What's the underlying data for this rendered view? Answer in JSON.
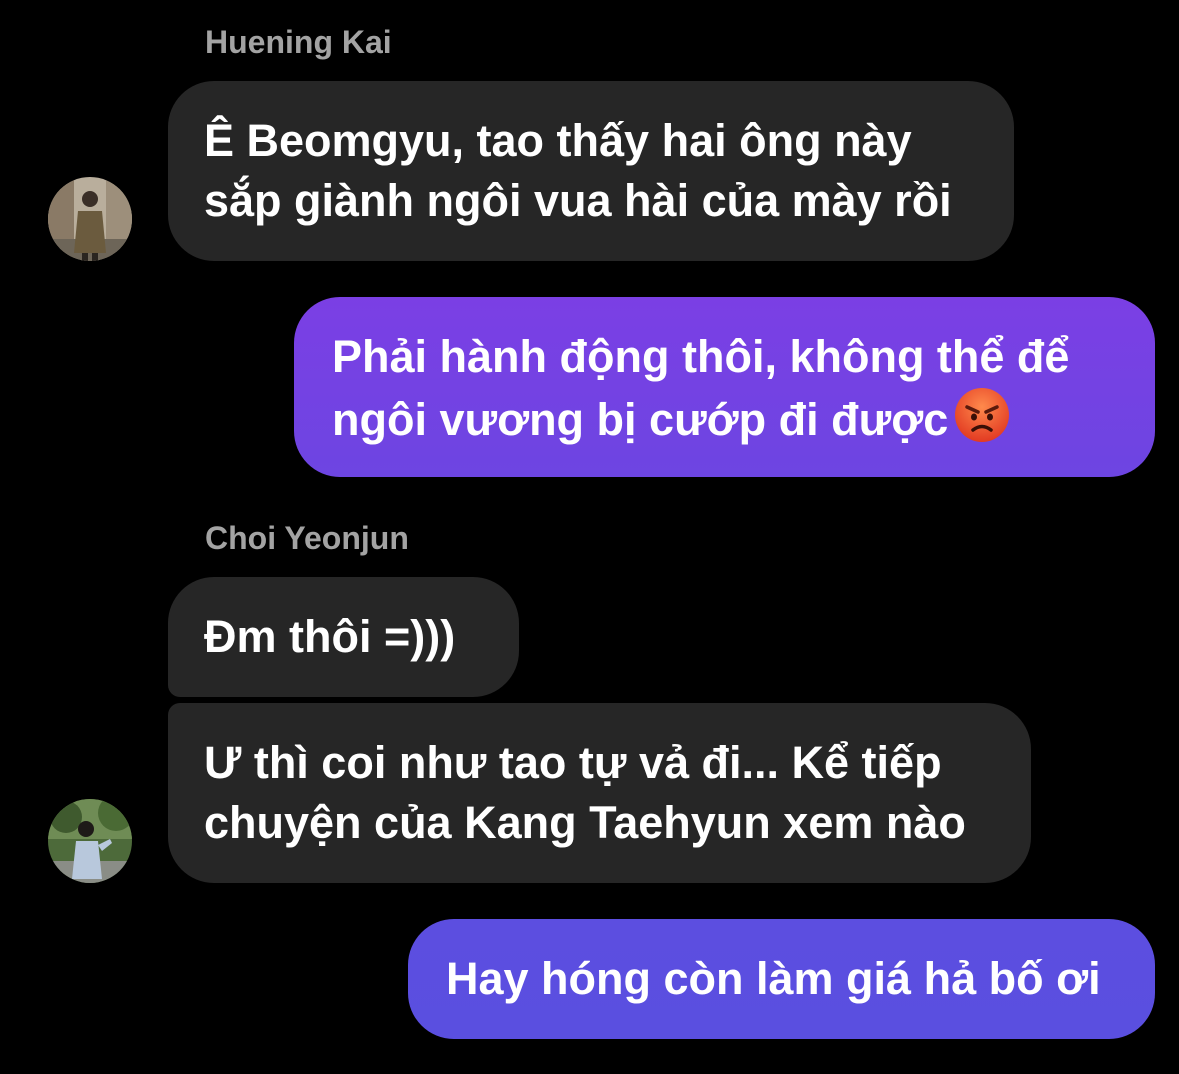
{
  "messages": [
    {
      "sender": "Huening Kai",
      "lines": [
        "Ê Beomgyu, tao thấy hai ông này",
        "sắp giành ngôi vua hài của mày rồi"
      ]
    },
    {
      "lines": [
        "Phải hành động thôi, không thể để",
        "ngôi vương bị cướp đi được"
      ],
      "emoji": "pouting-face-emoji"
    },
    {
      "sender": "Choi Yeonjun",
      "lines": [
        "Đm thôi =)))"
      ]
    },
    {
      "lines": [
        "Ư thì coi như tao tự vả đi... Kể tiếp",
        "chuyện của Kang Taehyun xem nào"
      ]
    },
    {
      "lines": [
        "Hay hóng còn làm giá hả bố ơi"
      ]
    }
  ],
  "colors": {
    "background": "#000000",
    "incoming_bubble": "#262626",
    "outgoing_gradient_top": "#7b3fe4",
    "outgoing_gradient_bottom": "#5a4fe0",
    "sender_name": "#a3a3a3"
  }
}
